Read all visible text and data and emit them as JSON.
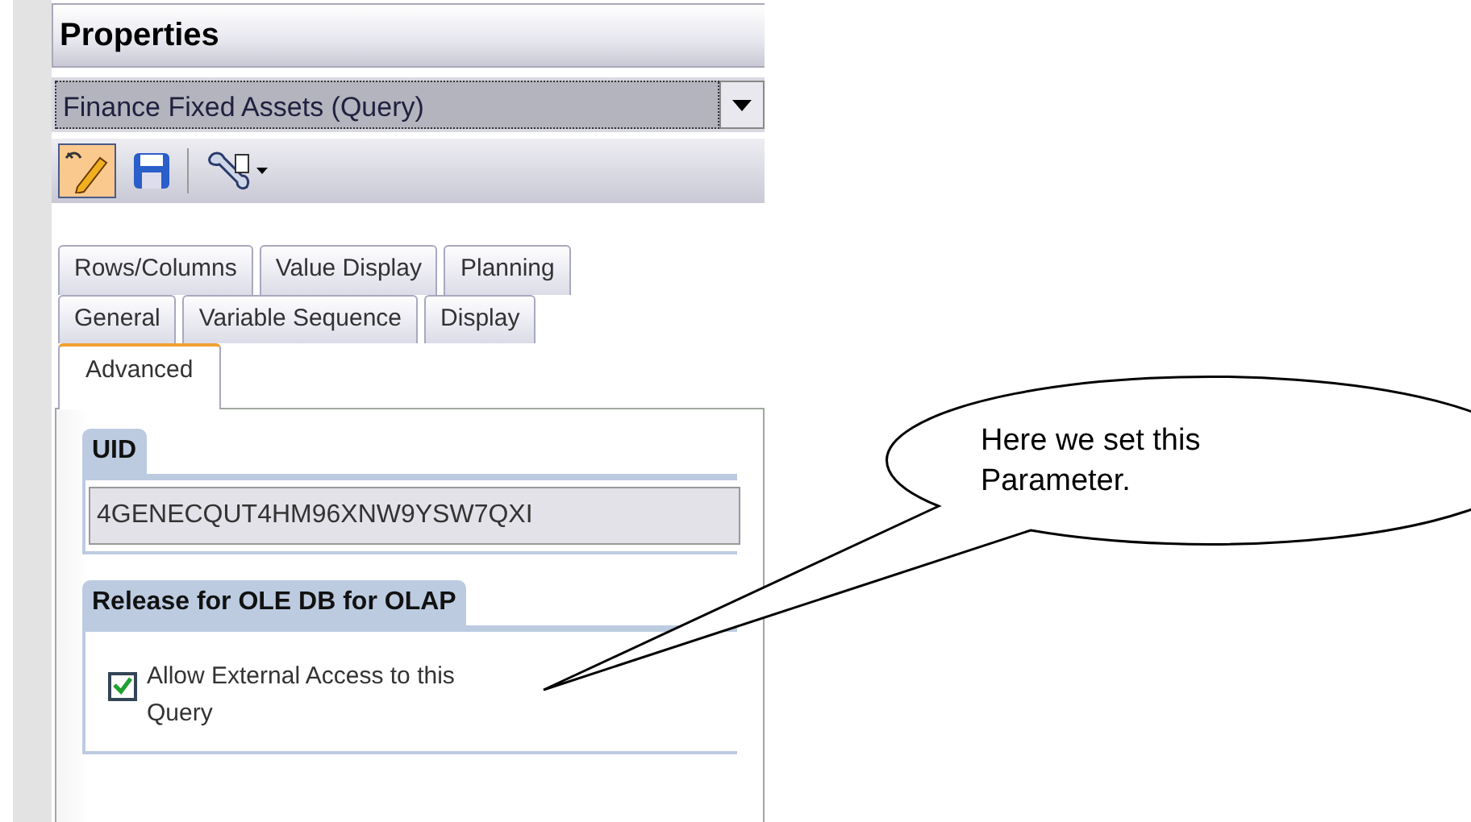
{
  "panel": {
    "title": "Properties"
  },
  "object_selector": {
    "value": "Finance Fixed Assets (Query)"
  },
  "toolbar": [
    {
      "kind": "edit",
      "selected": true
    },
    {
      "kind": "save",
      "selected": false
    },
    {
      "kind": "tools",
      "selected": false
    }
  ],
  "tab_rows": [
    [
      {
        "label": "Rows/Columns",
        "selected": false
      },
      {
        "label": "Value Display",
        "selected": false
      },
      {
        "label": "Planning",
        "selected": false
      }
    ],
    [
      {
        "label": "General",
        "selected": false
      },
      {
        "label": "Variable Sequence",
        "selected": false
      },
      {
        "label": "Display",
        "selected": false
      }
    ],
    [
      {
        "label": "Advanced",
        "selected": true
      }
    ]
  ],
  "uid_group": {
    "title": "UID",
    "value": "4GENECQUT4HM96XNW9YSW7QXI"
  },
  "release_group": {
    "title": "Release for OLE DB for OLAP",
    "checkbox": {
      "label": "Allow External Access to this Query",
      "checked": true
    }
  },
  "callout": {
    "text": "Here we set this Parameter."
  }
}
